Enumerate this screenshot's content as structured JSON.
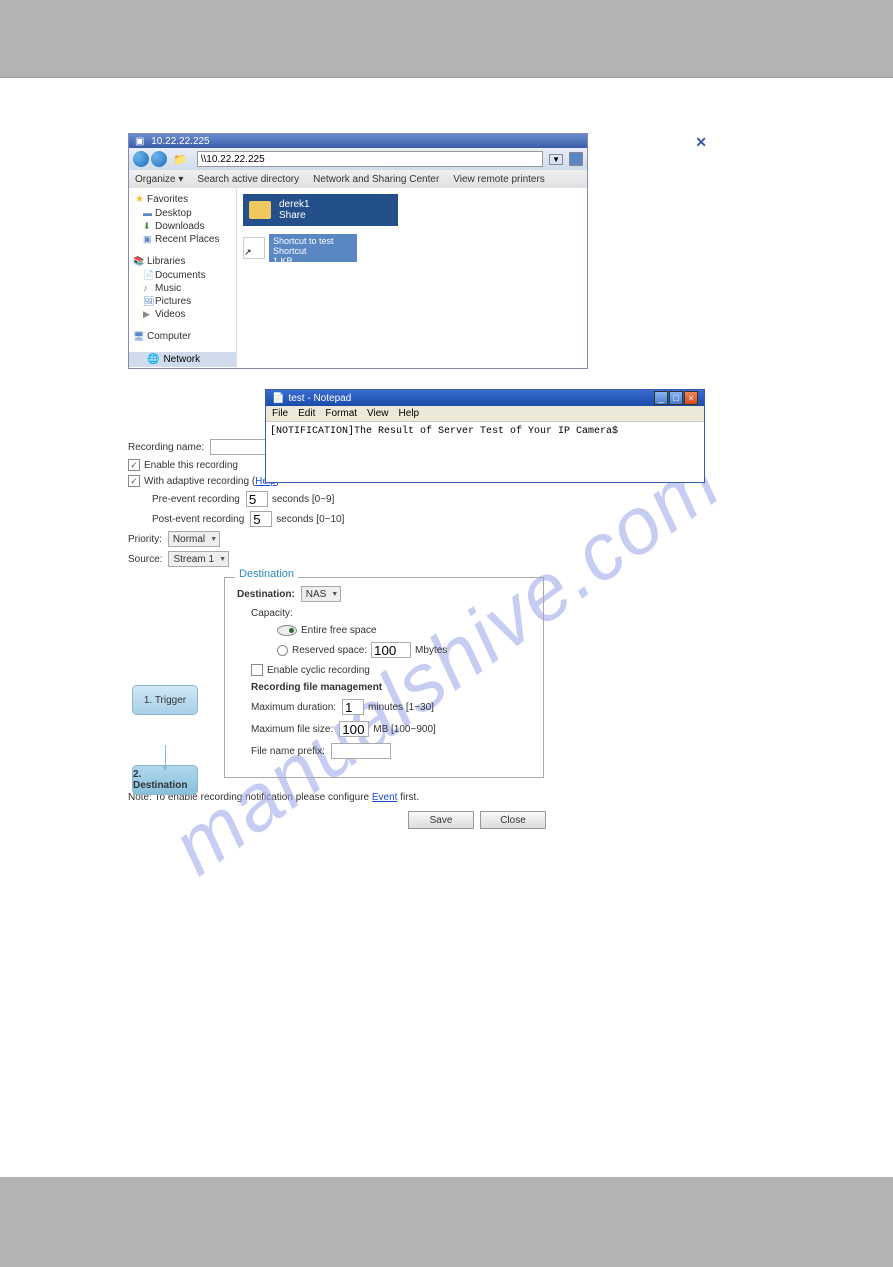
{
  "watermark": "manualshive.com",
  "explorer": {
    "title": "10.22.22.225",
    "address": "\\\\10.22.22.225",
    "toolbar": [
      "Organize ▾",
      "Search active directory",
      "Network and Sharing Center",
      "View remote printers"
    ],
    "sidebar": {
      "favorites": "Favorites",
      "fav_items": [
        "Desktop",
        "Downloads",
        "Recent Places"
      ],
      "libraries": "Libraries",
      "lib_items": [
        "Documents",
        "Music",
        "Pictures",
        "Videos"
      ],
      "computer": "Computer",
      "network": "Network"
    },
    "folder": {
      "name": "derek1",
      "sub": "Share"
    },
    "shortcut": {
      "l1": "Shortcut to test",
      "l2": "Shortcut",
      "l3": "1 KB"
    }
  },
  "notepad": {
    "title": "test - Notepad",
    "menu": [
      "File",
      "Edit",
      "Format",
      "View",
      "Help"
    ],
    "body": "[NOTIFICATION]The Result of Server Test of Your IP Camera$"
  },
  "form": {
    "rec_name_label": "Recording name:",
    "enable": "Enable this recording",
    "adaptive": "With adaptive recording (",
    "help": "Help",
    "pre_label": "Pre-event recording",
    "pre_val": "5",
    "pre_suffix": "seconds [0~9]",
    "post_label": "Post-event recording",
    "post_val": "5",
    "post_suffix": "seconds [0~10]",
    "priority_label": "Priority:",
    "priority_val": "Normal",
    "source_label": "Source:",
    "source_val": "Stream 1"
  },
  "tabs": {
    "trigger": "1. Trigger",
    "dest": "2. Destination"
  },
  "dest": {
    "box_label": "Destination",
    "dest_label": "Destination:",
    "dest_val": "NAS",
    "capacity": "Capacity:",
    "opt1": "Entire free space",
    "opt2": "Reserved space:",
    "opt2_val": "100",
    "opt2_unit": "Mbytes",
    "cyclic": "Enable cyclic recording",
    "rfm": "Recording file management",
    "max_dur_label": "Maximum duration:",
    "max_dur_val": "1",
    "max_dur_unit": "minutes [1~30]",
    "max_size_label": "Maximum file size:",
    "max_size_val": "100",
    "max_size_unit": "MB [100~900]",
    "prefix_label": "File name prefix:"
  },
  "note": {
    "pre": "Note: To enable recording notification please configure ",
    "link": "Event",
    "post": " first."
  },
  "buttons": {
    "save": "Save",
    "close": "Close"
  }
}
